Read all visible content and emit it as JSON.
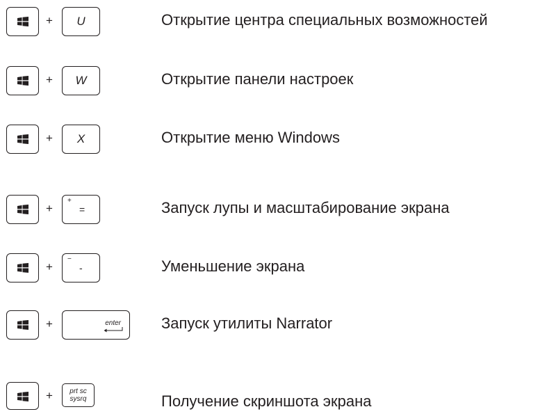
{
  "shortcuts": [
    {
      "key": "U",
      "description": "Открытие центра специальных возможностей"
    },
    {
      "key": "W",
      "description": "Открытие панели настроек"
    },
    {
      "key": "X",
      "description": "Открытие меню Windows"
    },
    {
      "key_top": "+",
      "key_main": "=",
      "description": "Запуск лупы и масштабирование экрана"
    },
    {
      "key_top": "−",
      "key_main": "-",
      "description": "Уменьшение экрана"
    },
    {
      "key": "enter",
      "description": "Запуск утилиты Narrator"
    },
    {
      "key_line1": "prt sc",
      "key_line2": "sysrq",
      "description": "Получение скриншота экрана"
    }
  ],
  "plus_sign": "+",
  "icons": {
    "windows_key": "windows-logo-icon",
    "enter_arrow": "enter-arrow-icon"
  }
}
